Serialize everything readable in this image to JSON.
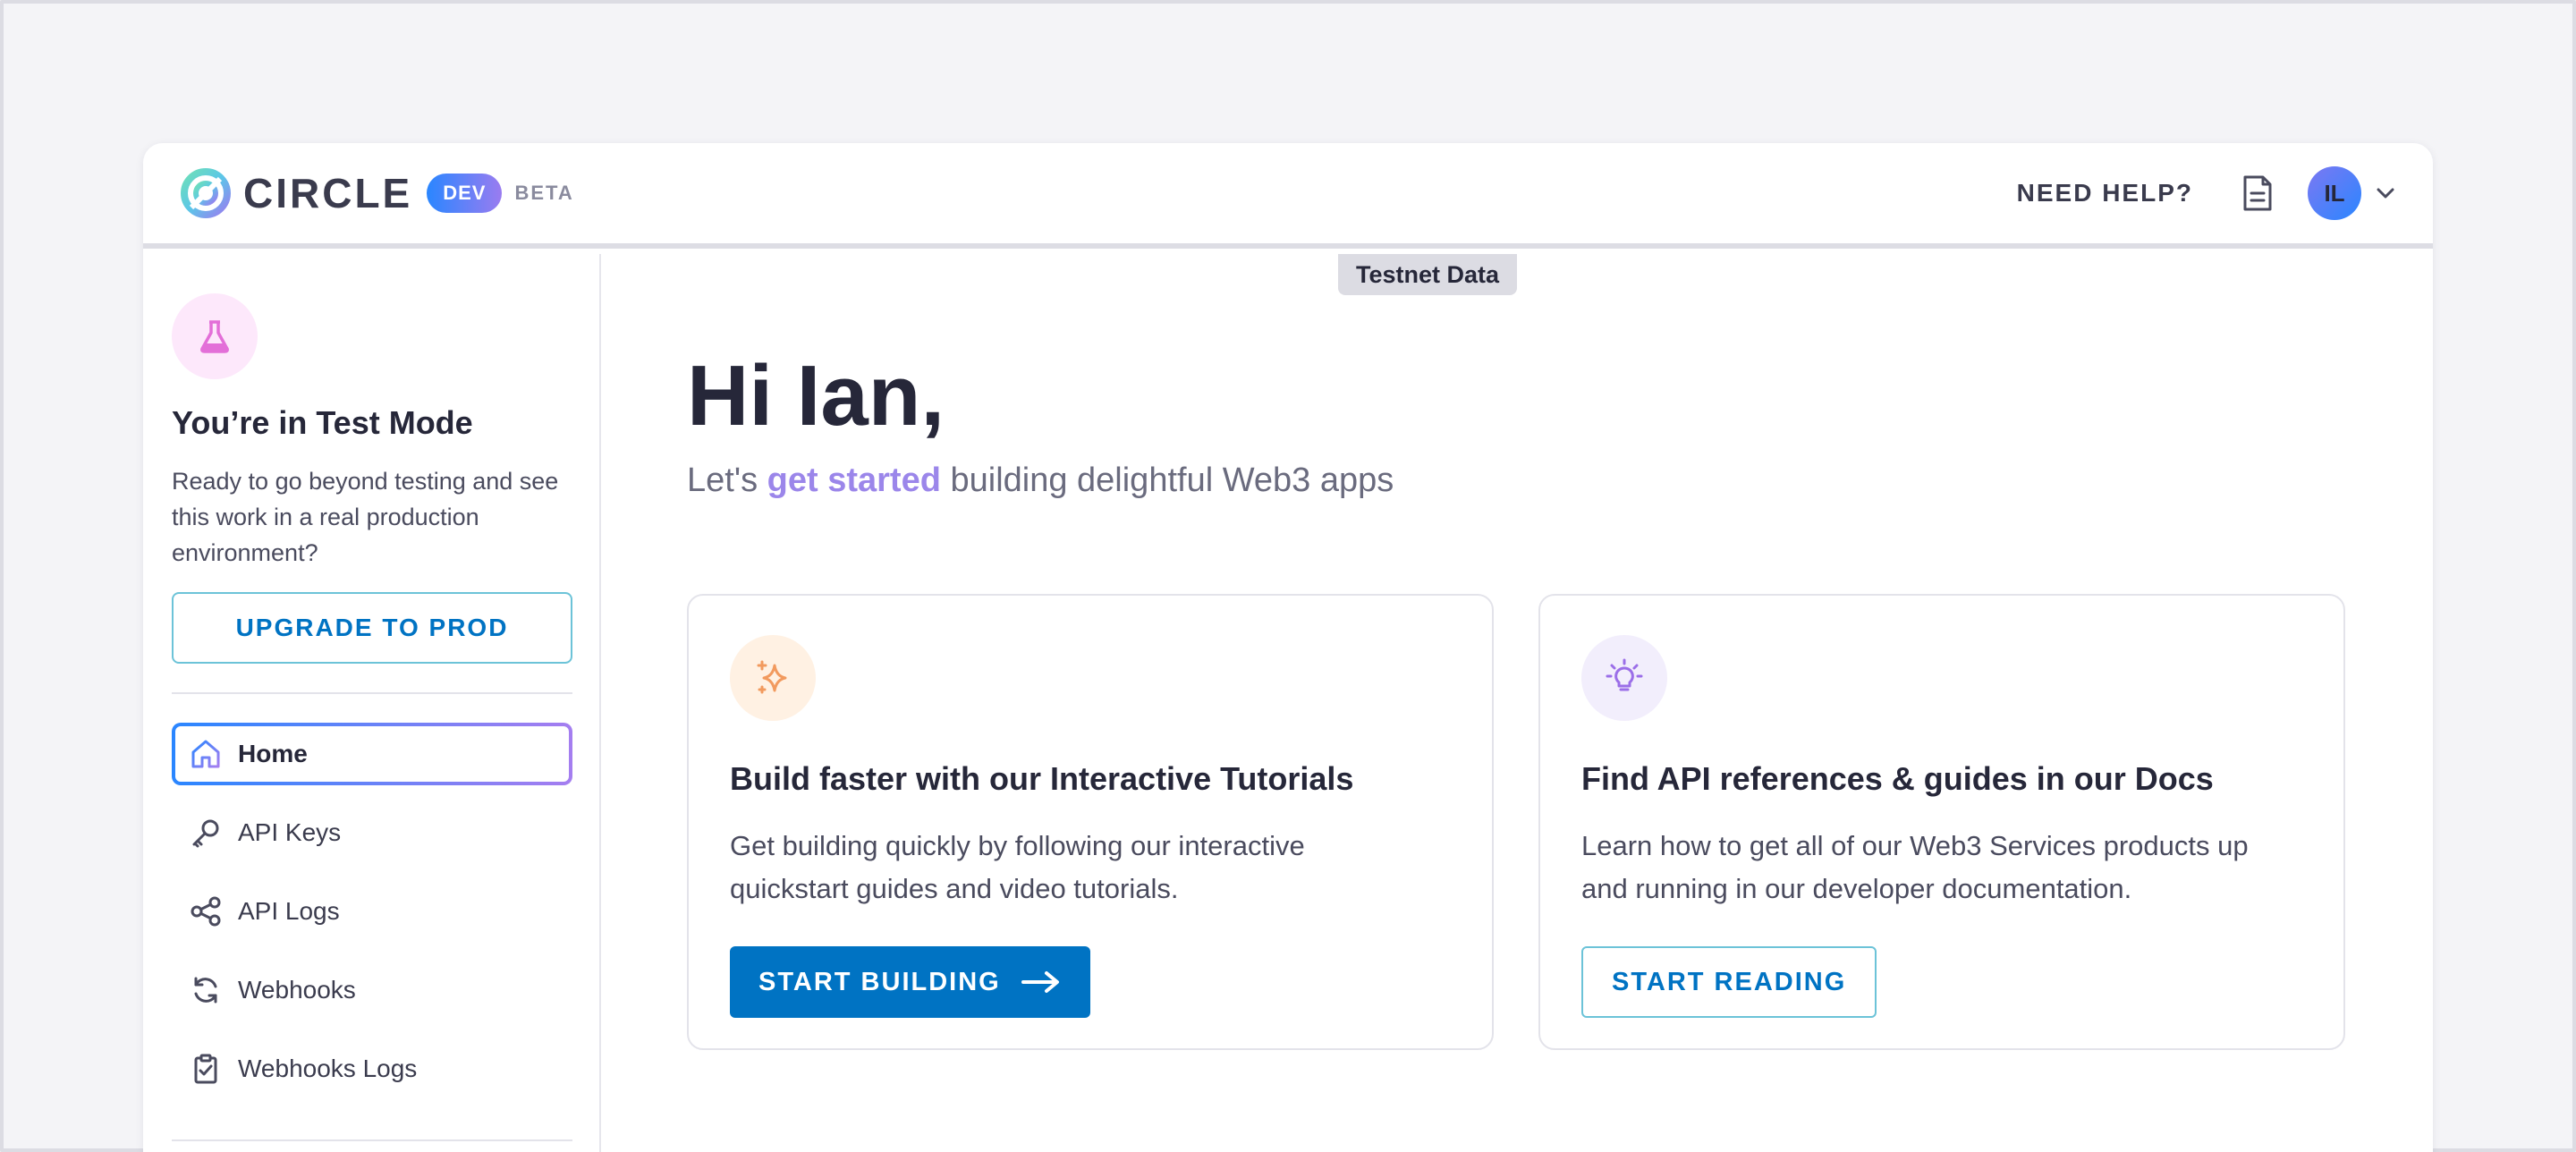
{
  "header": {
    "brand": "CIRCLE",
    "dev_badge": "DEV",
    "beta_label": "BETA",
    "help_link": "NEED HELP?",
    "docs_icon": "document-icon",
    "avatar_initials": "IL",
    "avatar_menu_icon": "chevron-down-icon"
  },
  "environment_tab": "Testnet Data",
  "sidebar": {
    "mode_icon": "flask-icon",
    "mode_title": "You’re in Test Mode",
    "mode_description": "Ready to go beyond testing and see this work in a real production environment?",
    "upgrade_button": "UPGRADE TO PROD",
    "nav": [
      {
        "label": "Home",
        "icon": "home-icon",
        "active": true
      },
      {
        "label": "API Keys",
        "icon": "key-icon",
        "active": false
      },
      {
        "label": "API Logs",
        "icon": "share-icon",
        "active": false
      },
      {
        "label": "Webhooks",
        "icon": "refresh-icon",
        "active": false
      },
      {
        "label": "Webhooks Logs",
        "icon": "clipboard-check-icon",
        "active": false
      }
    ]
  },
  "main": {
    "greeting": "Hi Ian,",
    "subtitle_prefix": "Let's ",
    "subtitle_accent": "get started",
    "subtitle_suffix": " building delightful Web3 apps",
    "cards": [
      {
        "icon": "sparkle-icon",
        "title": "Build faster with our Interactive Tutorials",
        "description": "Get building quickly by following our interactive quickstart guides and video tutorials.",
        "button": "START BUILDING",
        "button_icon": "arrow-right-icon"
      },
      {
        "icon": "lightbulb-icon",
        "title": "Find API references & guides in our Docs",
        "description": "Learn how to get all of our Web3 Services products up and running in our developer documentation.",
        "button": "START READING"
      }
    ]
  },
  "colors": {
    "primary": "#0073c3",
    "accent_purple": "#9b86ea",
    "text_dark": "#262739",
    "background": "#f4f4f7"
  }
}
